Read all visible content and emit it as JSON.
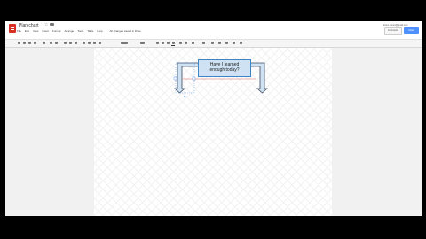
{
  "app": {
    "title": "Plan chart",
    "menu": [
      "File",
      "Edit",
      "View",
      "Insert",
      "Format",
      "Arrange",
      "Tools",
      "Table",
      "Help"
    ],
    "last_edit": "All changes saved in Drive",
    "user": "lorem.ipsum@gmail.com",
    "comments_label": "Comments",
    "share_label": "Share"
  },
  "diagram": {
    "callout_lines": [
      "Have I learned",
      "enough today?"
    ],
    "colors": {
      "callout_fill": "#cfe2f3",
      "callout_border": "#3d85c6",
      "arrow_fill": "#cfe2f3",
      "arrow_border": "#3d4a5c",
      "guide": "#e06666",
      "selection": "#4a86e8"
    }
  }
}
